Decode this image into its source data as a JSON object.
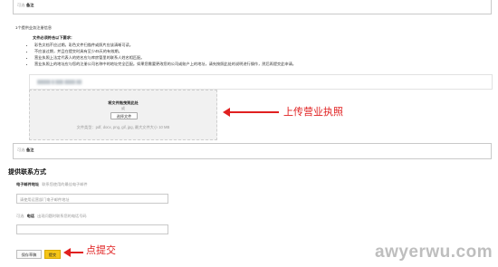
{
  "top_section": {
    "optional_tag": "可选",
    "remark_label": "备注"
  },
  "doc_section": {
    "intro": "1个提供业务注册信息",
    "req_title": "文件必须符合以下要求：",
    "reqs": [
      "彩色文档不应过期。彩色文件扫描件或照片应该清晰可读。",
      "不应该过期，并且在提交时具有至少45天的有效期。",
      "营业执照上法定代表人的姓名应与库房管里的联系人姓名相匹配。",
      "营业执照上的地址应与您的注册公司名称中的地址完全匹配。如果您需要更改您的公司或账户上的地址，请先按照此处的说明进行操作，然后再提交此申请。"
    ],
    "file_name_blur": "█████ █ ███ ████ ██"
  },
  "upload": {
    "drop_text": "将文件拖曳到此处",
    "or_text": "或",
    "button_label": "选择文件",
    "filetypes": "文件类型：pdf, docx, png, gif, jpg, 最大文件大小 10 MB"
  },
  "annotations": {
    "upload_label": "上传营业执照",
    "submit_label": "点提交"
  },
  "mid_section": {
    "optional_tag": "可选",
    "remark_label": "备注"
  },
  "contact": {
    "heading": "提供联系方式",
    "email_label": "电子邮件地址",
    "email_hint": "联系您使用的最佳电子邮件",
    "email_placeholder": "请使用运营部门电子邮件地址",
    "phone_optional": "可选",
    "phone_label": "电话",
    "phone_hint": "出现问题时联系您的电话号码"
  },
  "actions": {
    "save_draft": "保存草稿",
    "submit": "提交"
  },
  "watermark": "awyerwu.com",
  "colors": {
    "accent_red": "#e02020",
    "submit_yellow": "#f5c518"
  }
}
